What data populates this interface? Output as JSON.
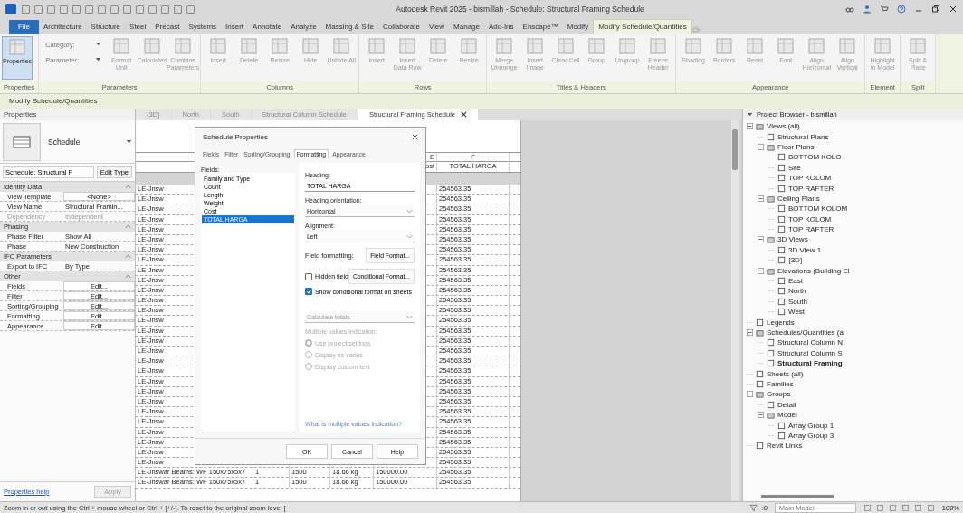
{
  "title_bar": {
    "title": "Autodesk Revit 2025 - bismillah - Schedule: Structural Framing Schedule"
  },
  "menu_tabs": [
    {
      "label": "File",
      "selected": false,
      "kind": "file"
    },
    {
      "label": "Architecture",
      "selected": false,
      "kind": "tab"
    },
    {
      "label": "Structure",
      "selected": false,
      "kind": "tab"
    },
    {
      "label": "Steel",
      "selected": false,
      "kind": "tab"
    },
    {
      "label": "Precast",
      "selected": false,
      "kind": "tab"
    },
    {
      "label": "Systems",
      "selected": false,
      "kind": "tab"
    },
    {
      "label": "Insert",
      "selected": false,
      "kind": "tab"
    },
    {
      "label": "Annotate",
      "selected": false,
      "kind": "tab"
    },
    {
      "label": "Analyze",
      "selected": false,
      "kind": "tab"
    },
    {
      "label": "Massing & Site",
      "selected": false,
      "kind": "tab"
    },
    {
      "label": "Collaborate",
      "selected": false,
      "kind": "tab"
    },
    {
      "label": "View",
      "selected": false,
      "kind": "tab"
    },
    {
      "label": "Manage",
      "selected": false,
      "kind": "tab"
    },
    {
      "label": "Add-Ins",
      "selected": false,
      "kind": "tab"
    },
    {
      "label": "Enscape™",
      "selected": false,
      "kind": "tab"
    },
    {
      "label": "Modify",
      "selected": false,
      "kind": "tab"
    },
    {
      "label": "Modify Schedule/Quantities",
      "selected": true,
      "kind": "context"
    }
  ],
  "ribbon": {
    "panels": [
      {
        "label": "Properties",
        "buttons": [
          {
            "kind": "large",
            "label": "Properties",
            "active": true,
            "disabled": false
          }
        ]
      },
      {
        "label": "Parameters",
        "buttons": [
          {
            "kind": "combos",
            "items": [
              "Category:",
              "Parameter:"
            ]
          },
          {
            "kind": "large",
            "label": "Format Unit",
            "active": false,
            "disabled": true
          },
          {
            "kind": "large",
            "label": "Calculated",
            "active": false,
            "disabled": true
          },
          {
            "kind": "large",
            "label": "Combine Parameters",
            "active": false,
            "disabled": true
          }
        ]
      },
      {
        "label": "Columns",
        "buttons": [
          {
            "kind": "large",
            "label": "Insert",
            "active": false,
            "disabled": true
          },
          {
            "kind": "large",
            "label": "Delete",
            "active": false,
            "disabled": true
          },
          {
            "kind": "large",
            "label": "Resize",
            "active": false,
            "disabled": true
          },
          {
            "kind": "large",
            "label": "Hide",
            "active": false,
            "disabled": true
          },
          {
            "kind": "large",
            "label": "Unhide All",
            "active": false,
            "disabled": true
          }
        ]
      },
      {
        "label": "Rows",
        "buttons": [
          {
            "kind": "large",
            "label": "Insert",
            "active": false,
            "disabled": true
          },
          {
            "kind": "large",
            "label": "Insert Data Row",
            "active": false,
            "disabled": true
          },
          {
            "kind": "large",
            "label": "Delete",
            "active": false,
            "disabled": true
          },
          {
            "kind": "large",
            "label": "Resize",
            "active": false,
            "disabled": true
          }
        ]
      },
      {
        "label": "Titles & Headers",
        "buttons": [
          {
            "kind": "large",
            "label": "Merge Unmerge",
            "active": false,
            "disabled": true
          },
          {
            "kind": "large",
            "label": "Insert Image",
            "active": false,
            "disabled": true
          },
          {
            "kind": "large",
            "label": "Clear Cell",
            "active": false,
            "disabled": true
          },
          {
            "kind": "large",
            "label": "Group",
            "active": false,
            "disabled": true
          },
          {
            "kind": "large",
            "label": "Ungroup",
            "active": false,
            "disabled": true
          },
          {
            "kind": "large",
            "label": "Freeze Header",
            "active": false,
            "disabled": true
          }
        ]
      },
      {
        "label": "Appearance",
        "buttons": [
          {
            "kind": "large",
            "label": "Shading",
            "active": false,
            "disabled": true
          },
          {
            "kind": "large",
            "label": "Borders",
            "active": false,
            "disabled": true
          },
          {
            "kind": "large",
            "label": "Reset",
            "active": false,
            "disabled": true
          },
          {
            "kind": "large",
            "label": "Font",
            "active": false,
            "disabled": true
          },
          {
            "kind": "large",
            "label": "Align Horizontal",
            "active": false,
            "disabled": true
          },
          {
            "kind": "large",
            "label": "Align Vertical",
            "active": false,
            "disabled": true
          }
        ]
      },
      {
        "label": "Element",
        "buttons": [
          {
            "kind": "large",
            "label": "Highlight in Model",
            "active": false,
            "disabled": true
          }
        ]
      },
      {
        "label": "Split",
        "buttons": [
          {
            "kind": "large",
            "label": "Split & Place",
            "active": false,
            "disabled": true
          }
        ]
      }
    ]
  },
  "context_bar": {
    "label": "Modify Schedule/Quantities"
  },
  "properties": {
    "title": "Properties",
    "type_name": "Schedule",
    "instance": "Schedule: Structural F",
    "edit_type": "Edit Type",
    "groups": [
      {
        "label": "Identity Data",
        "rows": [
          {
            "label": "View Template",
            "value": "<None>",
            "kind": "button",
            "disabled": false
          },
          {
            "label": "View Name",
            "value": "Structural Framin...",
            "kind": "text",
            "disabled": false
          },
          {
            "label": "Dependency",
            "value": "Independent",
            "kind": "text",
            "disabled": true
          }
        ]
      },
      {
        "label": "Phasing",
        "rows": [
          {
            "label": "Phase Filter",
            "value": "Show All",
            "kind": "text",
            "disabled": false
          },
          {
            "label": "Phase",
            "value": "New Construction",
            "kind": "text",
            "disabled": false
          }
        ]
      },
      {
        "label": "IFC Parameters",
        "rows": [
          {
            "label": "Export to IFC",
            "value": "By Type",
            "kind": "text",
            "disabled": false
          }
        ]
      },
      {
        "label": "Other",
        "rows": [
          {
            "label": "Fields",
            "value": "Edit...",
            "kind": "button",
            "disabled": false
          },
          {
            "label": "Filter",
            "value": "Edit...",
            "kind": "button",
            "disabled": false
          },
          {
            "label": "Sorting/Grouping",
            "value": "Edit...",
            "kind": "button",
            "disabled": false
          },
          {
            "label": "Formatting",
            "value": "Edit...",
            "kind": "button",
            "disabled": false
          },
          {
            "label": "Appearance",
            "value": "Edit...",
            "kind": "button",
            "disabled": false
          }
        ]
      }
    ],
    "help_link": "Properties help",
    "apply": "Apply"
  },
  "view_tabs": [
    {
      "label": "{3D}",
      "selected": false
    },
    {
      "label": "North",
      "selected": false
    },
    {
      "label": "South",
      "selected": false
    },
    {
      "label": "Structural Column Schedule",
      "selected": false
    },
    {
      "label": "Structural Framing Schedule",
      "selected": true
    }
  ],
  "schedule": {
    "columns": [
      {
        "letter": "E",
        "heading": "ost"
      },
      {
        "letter": "F",
        "heading": "TOTAL HARGA"
      }
    ],
    "rows": [
      {
        "kind": "partial",
        "cells": [
          "LE-Jnsw",
          "254563.35"
        ]
      },
      {
        "kind": "partial",
        "cells": [
          "LE-Jnsw",
          "254563.35"
        ]
      },
      {
        "kind": "partial",
        "cells": [
          "LE-Jnsw",
          "254563.35"
        ]
      },
      {
        "kind": "partial",
        "cells": [
          "LE-Jnsw",
          "254563.35"
        ]
      },
      {
        "kind": "partial",
        "cells": [
          "LE-Jnsw",
          "254563.35"
        ]
      },
      {
        "kind": "partial",
        "cells": [
          "LE-Jnsw",
          "254563.35"
        ]
      },
      {
        "kind": "partial",
        "cells": [
          "LE-Jnsw",
          "254563.35"
        ]
      },
      {
        "kind": "partial",
        "cells": [
          "LE-Jnsw",
          "254563.35"
        ]
      },
      {
        "kind": "partial",
        "cells": [
          "LE-Jnsw",
          "254563.35"
        ]
      },
      {
        "kind": "partial",
        "cells": [
          "LE-Jnsw",
          "254563.35"
        ]
      },
      {
        "kind": "partial",
        "cells": [
          "LE-Jnsw",
          "254563.35"
        ]
      },
      {
        "kind": "partial",
        "cells": [
          "LE-Jnsw",
          "254563.35"
        ]
      },
      {
        "kind": "partial",
        "cells": [
          "LE-Jnsw",
          "254563.35"
        ]
      },
      {
        "kind": "partial",
        "cells": [
          "LE-Jnsw",
          "254563.35"
        ]
      },
      {
        "kind": "partial",
        "cells": [
          "LE-Jnsw",
          "254563.35"
        ]
      },
      {
        "kind": "partial",
        "cells": [
          "LE-Jnsw",
          "254563.35"
        ]
      },
      {
        "kind": "partial",
        "cells": [
          "LE-Jnsw",
          "254563.35"
        ]
      },
      {
        "kind": "partial",
        "cells": [
          "LE-Jnsw",
          "254563.35"
        ]
      },
      {
        "kind": "partial",
        "cells": [
          "LE-Jnsw",
          "254563.35"
        ]
      },
      {
        "kind": "partial",
        "cells": [
          "LE-Jnsw",
          "254563.35"
        ]
      },
      {
        "kind": "partial",
        "cells": [
          "LE-Jnsw",
          "254563.35"
        ]
      },
      {
        "kind": "partial",
        "cells": [
          "LE-Jnsw",
          "254563.35"
        ]
      },
      {
        "kind": "partial",
        "cells": [
          "LE-Jnsw",
          "254563.35"
        ]
      },
      {
        "kind": "partial",
        "cells": [
          "LE-Jnsw",
          "254563.35"
        ]
      },
      {
        "kind": "partial",
        "cells": [
          "LE-Jnsw",
          "254563.35"
        ]
      },
      {
        "kind": "partial",
        "cells": [
          "LE-Jnsw",
          "254563.35"
        ]
      },
      {
        "kind": "partial",
        "cells": [
          "LE-Jnsw",
          "254563.35"
        ]
      },
      {
        "kind": "partial",
        "cells": [
          "LE-Jnsw",
          "254563.35"
        ]
      },
      {
        "kind": "full",
        "cells": [
          "LE-Jnswar Beams: WF 150x75x5x7",
          "1",
          "1500",
          "18.66 kg",
          "150000.00",
          "254563.35"
        ]
      },
      {
        "kind": "full",
        "cells": [
          "LE-Jnswar Beams: WF 150x75x5x7",
          "1",
          "1500",
          "18.66 kg",
          "150000.00",
          "254563.35"
        ]
      }
    ]
  },
  "dialog": {
    "title": "Schedule Properties",
    "tabs": [
      {
        "label": "Fields",
        "selected": false
      },
      {
        "label": "Filter",
        "selected": false
      },
      {
        "label": "Sorting/Grouping",
        "selected": false
      },
      {
        "label": "Formatting",
        "selected": true
      },
      {
        "label": "Appearance",
        "selected": false
      }
    ],
    "fields_label": "Fields:",
    "fields": [
      {
        "label": "Family and Type",
        "selected": false
      },
      {
        "label": "Count",
        "selected": false
      },
      {
        "label": "Length",
        "selected": false
      },
      {
        "label": "Weight",
        "selected": false
      },
      {
        "label": "Cost",
        "selected": false
      },
      {
        "label": "TOTAL HARGA",
        "selected": true
      }
    ],
    "heading_label": "Heading:",
    "heading_value": "TOTAL HARGA",
    "orientation_label": "Heading orientation:",
    "orientation_value": "Horizontal",
    "alignment_label": "Alignment:",
    "alignment_value": "Left",
    "field_formatting_label": "Field formatting:",
    "field_format_button": "Field Format...",
    "hidden_field": {
      "label": "Hidden field",
      "checked": false
    },
    "conditional_format_button": "Conditional Format...",
    "show_conditional": {
      "label": "Show conditional format on sheets",
      "checked": true
    },
    "totals": {
      "value": "Calculate totals",
      "disabled": true
    },
    "multiple_values_label": "Multiple values indication:",
    "radios": [
      {
        "label": "Use project settings",
        "selected": true
      },
      {
        "label": "Display as varies",
        "selected": false
      },
      {
        "label": "Display custom text",
        "selected": false
      }
    ],
    "help_link": "What is multiple values indication?",
    "buttons": [
      "OK",
      "Cancel",
      "Help"
    ]
  },
  "project_browser": {
    "title": "Project Browser - bismillah",
    "tree": [
      {
        "label": "Views (all)",
        "selected": false,
        "children": [
          {
            "label": "Structural Plans",
            "selected": false
          },
          {
            "label": "Floor Plans",
            "selected": false,
            "children": [
              {
                "label": "BOTTOM KOLO",
                "selected": false
              },
              {
                "label": "Site",
                "selected": false
              },
              {
                "label": "TOP KOLOM",
                "selected": false
              },
              {
                "label": "TOP RAFTER",
                "selected": false
              }
            ]
          },
          {
            "label": "Ceiling Plans",
            "selected": false,
            "children": [
              {
                "label": "BOTTOM KOLOM",
                "selected": false
              },
              {
                "label": "TOP KOLOM",
                "selected": false
              },
              {
                "label": "TOP RAFTER",
                "selected": false
              }
            ]
          },
          {
            "label": "3D Views",
            "selected": false,
            "children": [
              {
                "label": "3D View 1",
                "selected": false
              },
              {
                "label": "{3D}",
                "selected": false
              }
            ]
          },
          {
            "label": "Elevations (Building El",
            "selected": false,
            "children": [
              {
                "label": "East",
                "selected": false
              },
              {
                "label": "North",
                "selected": false
              },
              {
                "label": "South",
                "selected": false
              },
              {
                "label": "West",
                "selected": false
              }
            ]
          }
        ]
      },
      {
        "label": "Legends",
        "selected": false
      },
      {
        "label": "Schedules/Quantities (a",
        "selected": false,
        "children": [
          {
            "label": "Structural Column N",
            "selected": false
          },
          {
            "label": "Structural Column S",
            "selected": false
          },
          {
            "label": "Structural Framing",
            "selected": true
          }
        ]
      },
      {
        "label": "Sheets (all)",
        "selected": false
      },
      {
        "label": "Families",
        "selected": false
      },
      {
        "label": "Groups",
        "selected": false,
        "children": [
          {
            "label": "Detail",
            "selected": false
          },
          {
            "label": "Model",
            "selected": false,
            "children": [
              {
                "label": "Array Group 1",
                "selected": false
              },
              {
                "label": "Array Group 3",
                "selected": false
              }
            ]
          }
        ]
      },
      {
        "label": "Revit Links",
        "selected": false
      }
    ]
  },
  "status_bar": {
    "message": "Zoom in or out using the Ctrl + mouse wheel or Ctrl + [+/-]. To reset to the original zoom level [",
    "filter_count": ":0",
    "model": "Main Model",
    "zoom": "100%"
  }
}
